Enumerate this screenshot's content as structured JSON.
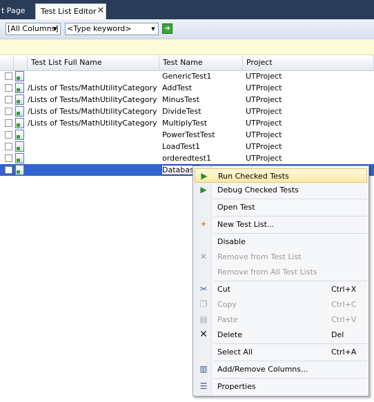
{
  "tabs": {
    "start_page": "t Page",
    "test_list_editor": "Test List Editor",
    "close": "✕"
  },
  "toolbar": {
    "columns_filter": "[All Columns]",
    "keyword_placeholder": "<Type keyword>",
    "go": "➜"
  },
  "grid": {
    "headers": {
      "full_name": "Test List Full Name",
      "test_name": "Test Name",
      "project": "Project"
    },
    "rows": [
      {
        "checked": false,
        "full_name": "",
        "test_name": "GenericTest1",
        "project": "UTProject"
      },
      {
        "checked": false,
        "full_name": "/Lists of Tests/MathUtilityCategory",
        "test_name": "AddTest",
        "project": "UTProject"
      },
      {
        "checked": false,
        "full_name": "/Lists of Tests/MathUtilityCategory",
        "test_name": "MinusTest",
        "project": "UTProject"
      },
      {
        "checked": false,
        "full_name": "/Lists of Tests/MathUtilityCategory",
        "test_name": "DivideTest",
        "project": "UTProject"
      },
      {
        "checked": false,
        "full_name": "/Lists of Tests/MathUtilityCategory",
        "test_name": "MultiplyTest",
        "project": "UTProject"
      },
      {
        "checked": false,
        "full_name": "",
        "test_name": "PowerTestTest",
        "project": "UTProject"
      },
      {
        "checked": false,
        "full_name": "",
        "test_name": "LoadTest1",
        "project": "UTProject"
      },
      {
        "checked": false,
        "full_name": "",
        "test_name": "orderedtest1",
        "project": "UTProject"
      },
      {
        "checked": true,
        "full_name": "",
        "test_name": "Database",
        "project": ""
      }
    ]
  },
  "context_menu": {
    "run_checked": "Run Checked Tests",
    "debug_checked": "Debug Checked Tests",
    "open_test": "Open Test",
    "new_test_list": "New Test List...",
    "disable": "Disable",
    "remove_from_list": "Remove from Test List",
    "remove_from_all": "Remove from All Test Lists",
    "cut": "Cut",
    "cut_key": "Ctrl+X",
    "copy": "Copy",
    "copy_key": "Ctrl+C",
    "paste": "Paste",
    "paste_key": "Ctrl+V",
    "delete": "Delete",
    "delete_key": "Del",
    "select_all": "Select All",
    "select_all_key": "Ctrl+A",
    "add_remove_columns": "Add/Remove Columns...",
    "properties": "Properties"
  }
}
